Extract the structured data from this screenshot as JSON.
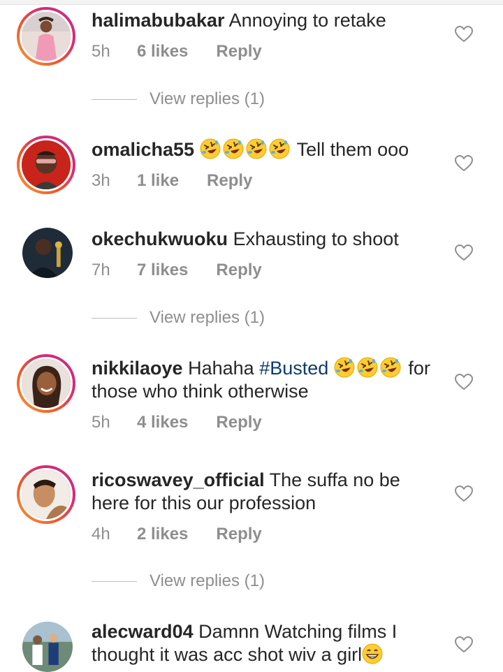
{
  "comments": [
    {
      "username": "halimabubakar",
      "text_before": "Annoying to retake",
      "time": "5h",
      "likes": "6 likes",
      "reply": "Reply",
      "avatar": "woman-pink-dress-avatar",
      "story_ring": true
    },
    {
      "username": "omalicha55",
      "emojis": [
        "rolling-on-floor-laughing",
        "rolling-on-floor-laughing",
        "rolling-on-floor-laughing",
        "rolling-on-floor-laughing"
      ],
      "text_after": "Tell them ooo",
      "time": "3h",
      "likes": "1 like",
      "reply": "Reply",
      "avatar": "man-red-background-avatar",
      "story_ring": true
    },
    {
      "username": "okechukwuoku",
      "text_before": "Exhausting to shoot",
      "time": "7h",
      "likes": "7 likes",
      "reply": "Reply",
      "avatar": "man-with-award-avatar",
      "story_ring": false
    },
    {
      "username": "nikkilaoye",
      "text_before": "Hahaha",
      "hashtag": "#Busted",
      "emojis": [
        "rolling-on-floor-laughing",
        "rolling-on-floor-laughing",
        "rolling-on-floor-laughing"
      ],
      "text_after": "for",
      "text_line2": "those who think otherwise",
      "time": "5h",
      "likes": "4 likes",
      "reply": "Reply",
      "avatar": "smiling-woman-avatar",
      "story_ring": true
    },
    {
      "username": "ricoswavey_official",
      "text_before": "The suffa no be",
      "text_line2": "here for this our profession",
      "time": "4h",
      "likes": "2 likes",
      "reply": "Reply",
      "avatar": "young-man-selfie-avatar",
      "story_ring": true
    },
    {
      "username": "alecward04",
      "text_before": "Damnn Watching films I",
      "text_line2": "thought it was acc shot wiv a girl",
      "emojis": [
        "grinning-face"
      ],
      "avatar": "group-photo-avatar",
      "story_ring": false
    }
  ],
  "view_replies": [
    "View replies (1)",
    "View replies (1)",
    "View replies (1)"
  ],
  "colors": {
    "username": "#262626",
    "text": "#262626",
    "meta": "#8e8e8e",
    "hashtag": "#0c3c6e",
    "story_ring_start": "#f9a03f",
    "story_ring_end": "#c13584"
  },
  "icons": {
    "like": "heart-outline-icon"
  }
}
